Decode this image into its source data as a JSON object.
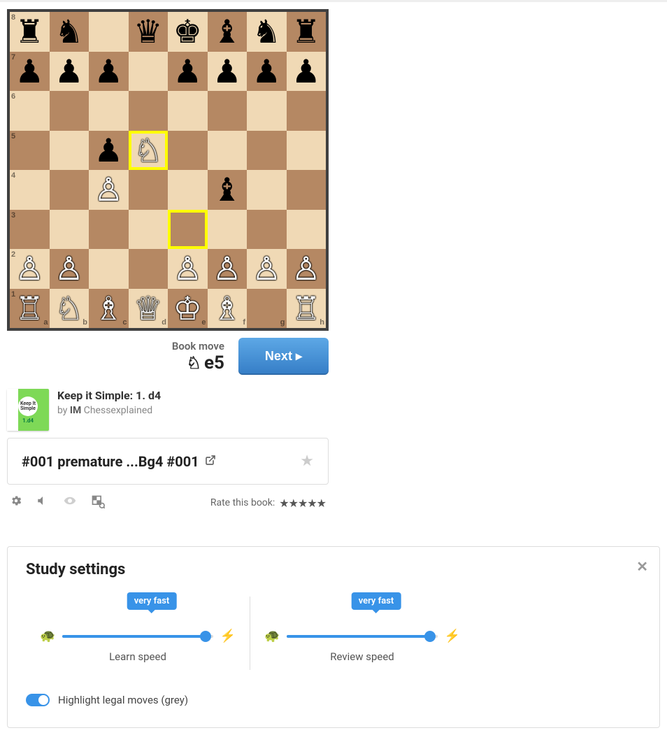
{
  "board": {
    "orientation": "white",
    "ranks": [
      "8",
      "7",
      "6",
      "5",
      "4",
      "3",
      "2",
      "1"
    ],
    "files": [
      "a",
      "b",
      "c",
      "d",
      "e",
      "f",
      "g",
      "h"
    ],
    "highlight_from": "e3",
    "highlight_to": "d5",
    "position": {
      "a8": "br",
      "b8": "bn",
      "d8": "bq",
      "e8": "bk",
      "f8": "bb",
      "g8": "bn",
      "h8": "br",
      "a7": "bp",
      "b7": "bp",
      "c7": "bp",
      "e7": "bp",
      "f7": "bp",
      "g7": "bp",
      "h7": "bp",
      "c5": "bp",
      "d5": "wn",
      "c4": "wp",
      "f4": "bb",
      "a2": "wp",
      "b2": "wp",
      "e2": "wp",
      "f2": "wp",
      "g2": "wp",
      "h2": "wp",
      "a1": "wr",
      "b1": "wn",
      "c1": "wb",
      "d1": "wq",
      "e1": "wk",
      "f1": "wb",
      "h1": "wr"
    }
  },
  "move_hint": {
    "label": "Book move",
    "piece_glyph": "♘",
    "san": "e5"
  },
  "next_button": "Next",
  "book": {
    "cover_line1": "Keep It Simple",
    "cover_line2": "1.d4",
    "title": "Keep it Simple: 1. d4",
    "by_prefix": "by ",
    "author_title": "IM",
    "author_name": "Chessexplained"
  },
  "chapter": {
    "title": "#001 premature ...Bg4 #001"
  },
  "rate_label": "Rate this book:",
  "rate_stars": "★★★★★",
  "settings": {
    "heading": "Study settings",
    "learn": {
      "tag": "very fast",
      "label": "Learn speed",
      "pct": 95
    },
    "review": {
      "tag": "very fast",
      "label": "Review speed",
      "pct": 95
    },
    "toggle_label": "Highlight legal moves (grey)",
    "toggle_on": true
  }
}
